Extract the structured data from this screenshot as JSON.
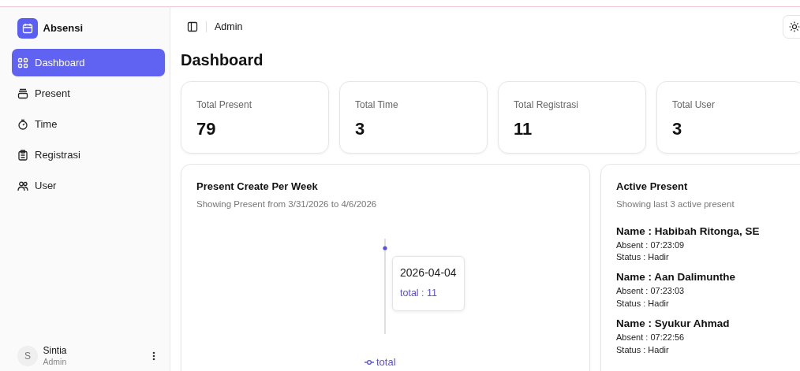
{
  "app": {
    "name": "Absensi"
  },
  "sidebar": {
    "items": [
      {
        "label": "Dashboard",
        "kind": "grid",
        "selected": true
      },
      {
        "label": "Present",
        "kind": "tray",
        "selected": false
      },
      {
        "label": "Time",
        "kind": "timer",
        "selected": false
      },
      {
        "label": "Registrasi",
        "kind": "clipboard",
        "selected": false
      },
      {
        "label": "User",
        "kind": "users",
        "selected": false
      }
    ]
  },
  "user": {
    "initial": "S",
    "name": "Sintia",
    "role": "Admin"
  },
  "header": {
    "breadcrumb": "Admin"
  },
  "page_title": "Dashboard",
  "stats": [
    {
      "label": "Total Present",
      "value": "79"
    },
    {
      "label": "Total Time",
      "value": "3"
    },
    {
      "label": "Total Registrasi",
      "value": "11"
    },
    {
      "label": "Total User",
      "value": "3"
    }
  ],
  "chart_panel": {
    "title": "Present Create Per Week",
    "subtitle": "Showing Present from 3/31/2026 to 4/6/2026",
    "tooltip": {
      "date": "2026-04-04",
      "value_text": "total : 11"
    },
    "legend": "total"
  },
  "active_panel": {
    "title": "Active Present",
    "subtitle": "Showing last 3 active present",
    "entries": [
      {
        "name": "Name : Habibah Ritonga, SE",
        "absent": "Absent : 07:23:09",
        "status": "Status : Hadir"
      },
      {
        "name": "Name : Aan Dalimunthe",
        "absent": "Absent : 07:23:03",
        "status": "Status : Hadir"
      },
      {
        "name": "Name : Syukur Ahmad",
        "absent": "Absent : 07:22:56",
        "status": "Status : Hadir"
      }
    ]
  }
}
